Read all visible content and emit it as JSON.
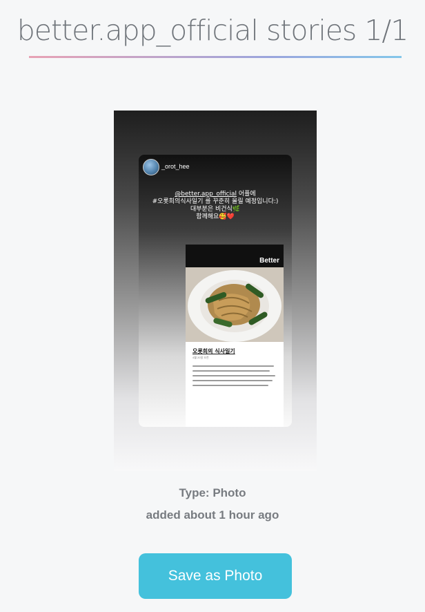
{
  "header": {
    "title": "better.app_official stories 1/1"
  },
  "story": {
    "username": "_orot_hee",
    "caption_line1_prefix": "@better.app_official",
    "caption_line1_suffix": " 어플에",
    "caption_line2": "#오롯희의식사일기 를 꾸준히 올릴 예정입니다:)",
    "caption_line3": "대부분은 비건식🌿",
    "caption_line4": "함께해요🥰❤️",
    "post_brand": "Better",
    "post_title": "오롯희의 식사일기",
    "post_date": "4월 20일 오전"
  },
  "meta": {
    "type_text": "Type: Photo",
    "added_text": "added about 1 hour ago"
  },
  "actions": {
    "save_label": "Save as Photo"
  },
  "colors": {
    "accent": "#44c1dc",
    "text_muted": "#777b80"
  }
}
